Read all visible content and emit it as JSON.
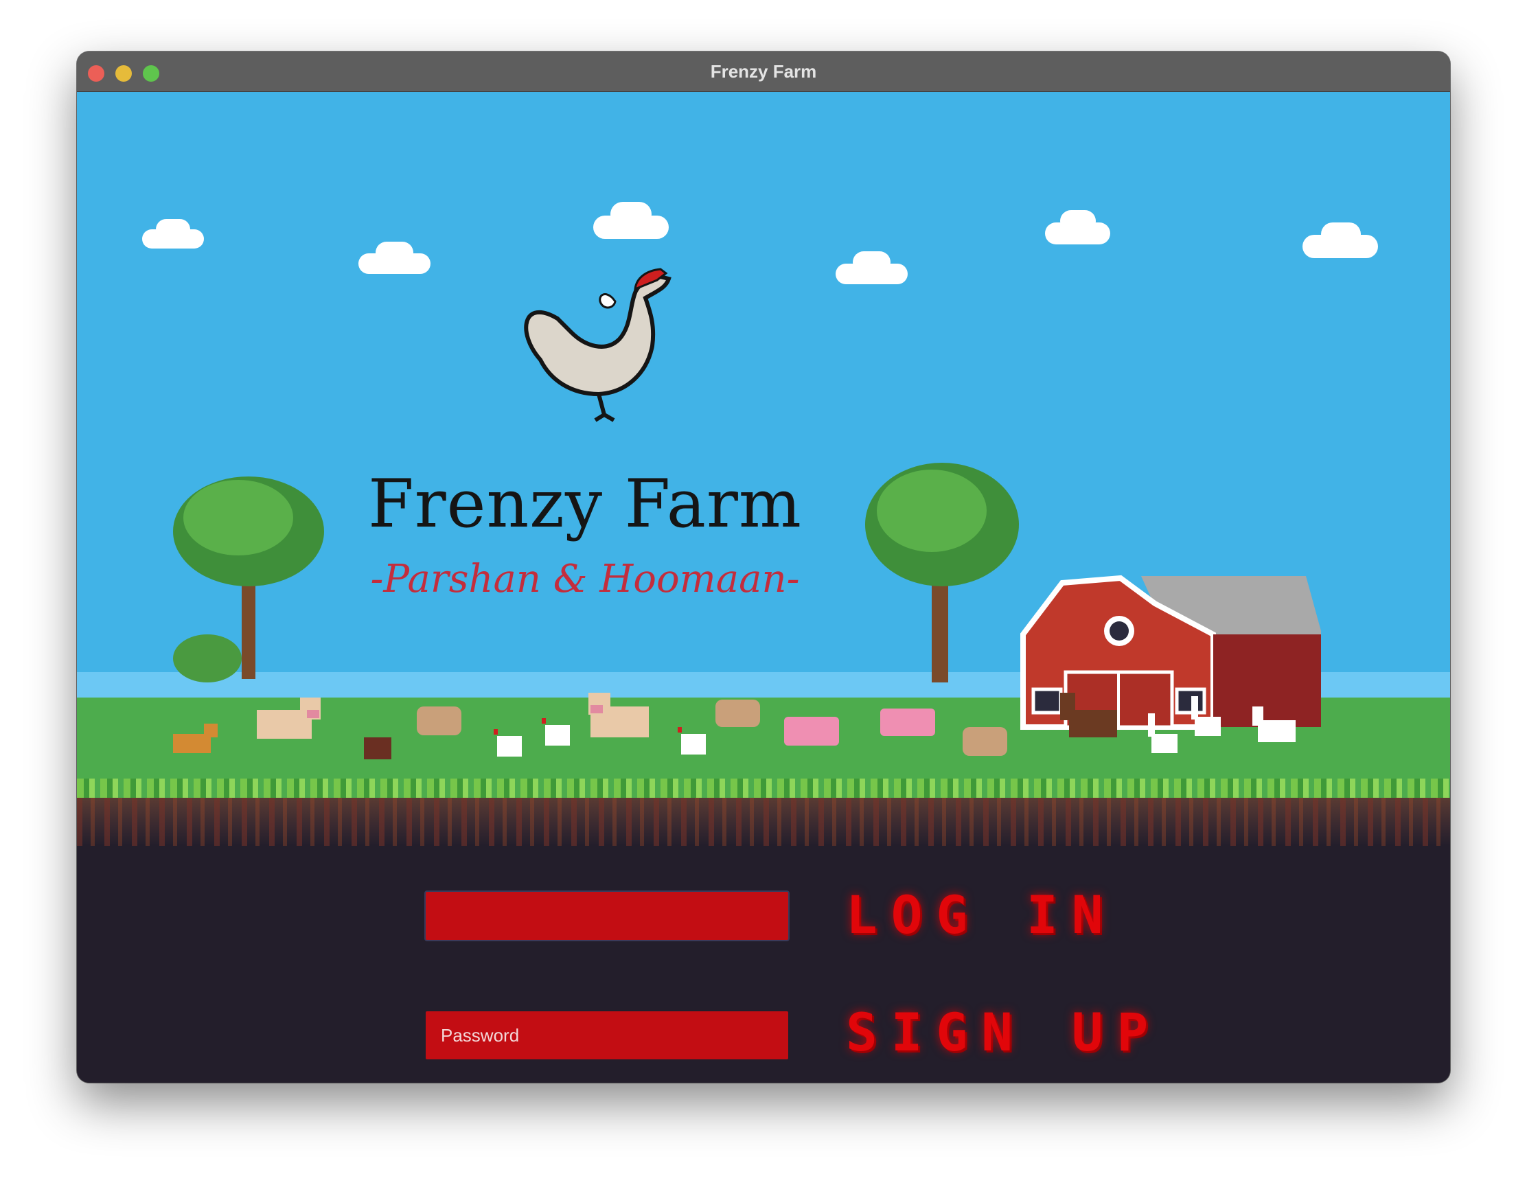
{
  "window": {
    "title": "Frenzy Farm"
  },
  "logo": {
    "title": "Frenzy Farm",
    "subtitle": "-Parshan & Hoomaan-"
  },
  "form": {
    "username_value": "",
    "password_placeholder": "Password",
    "login_label": "LOG IN",
    "signup_label": "SIGN UP"
  },
  "colors": {
    "sky": "#41b3e7",
    "grass": "#4dac4d",
    "ground": "#231e2b",
    "field": "#c30d13",
    "button_text": "#e1060a",
    "barn": "#c0392b"
  },
  "icons": [
    "rooster-icon",
    "barn-icon",
    "tree-icon",
    "cloud-icon",
    "cow-icon",
    "pig-icon",
    "sheep-icon",
    "chicken-icon",
    "horse-icon",
    "goat-icon",
    "duck-icon",
    "dog-icon",
    "turkey-icon"
  ]
}
